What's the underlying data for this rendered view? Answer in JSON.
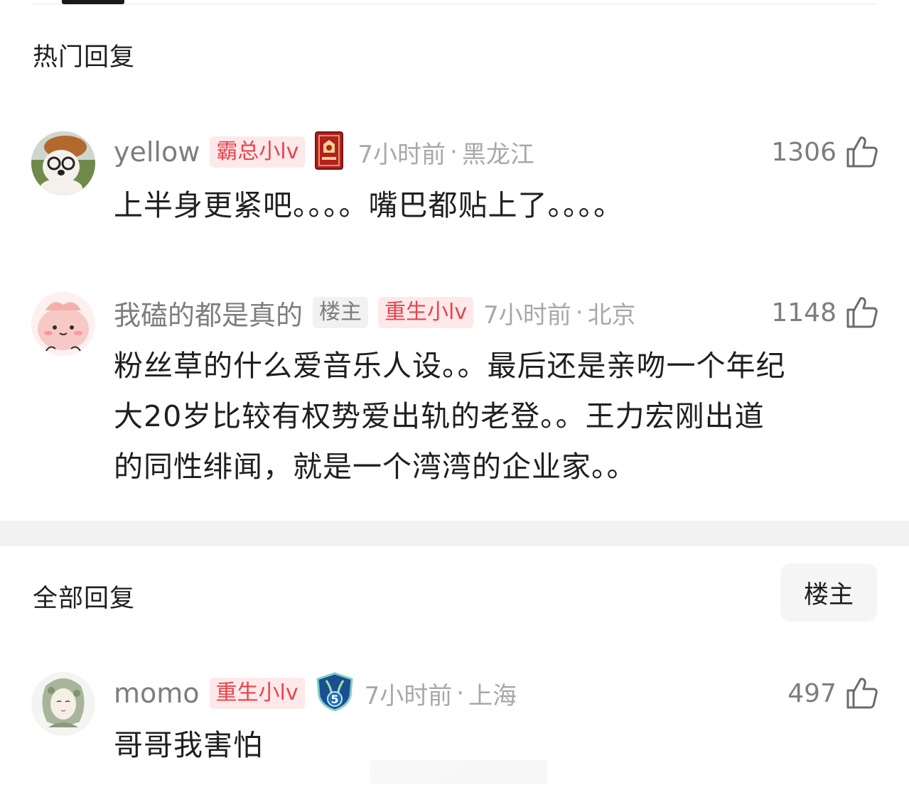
{
  "hot_section": {
    "title": "热门回复"
  },
  "all_section": {
    "title": "全部回复",
    "filter_label": "楼主"
  },
  "hot_comments": [
    {
      "username": "yellow",
      "badges": [
        "霸总小lv"
      ],
      "time": "7小时前",
      "separator": "·",
      "location": "黑龙江",
      "likes": "1306",
      "content": "上半身更紧吧。。。。嘴巴都贴上了。。。。"
    },
    {
      "username": "我磕的都是真的",
      "badges": [
        "楼主",
        "重生小lv"
      ],
      "time": "7小时前",
      "separator": "·",
      "location": "北京",
      "likes": "1148",
      "content_lines": [
        "粉丝草的什么爱音乐人设。。最后还是亲吻一个年纪",
        "大20岁比较有权势爱出轨的老登。。王力宏刚出道",
        "的同性绯闻，就是一个湾湾的企业家。。"
      ]
    }
  ],
  "all_comments": [
    {
      "username": "momo",
      "badges": [
        "重生小lv"
      ],
      "medal_level": "5",
      "time": "7小时前",
      "separator": "·",
      "location": "上海",
      "likes": "497",
      "content": "哥哥我害怕"
    }
  ],
  "icons": {
    "like": "thumbs-up-icon",
    "medal_red": "red-card-medal-icon",
    "medal_shield": "shield-level-icon"
  },
  "colors": {
    "badge_red_text": "#e8434c",
    "badge_red_bg": "#fde9ea",
    "meta_gray": "#a8a8a8",
    "username_gray": "#7d7d7d"
  }
}
